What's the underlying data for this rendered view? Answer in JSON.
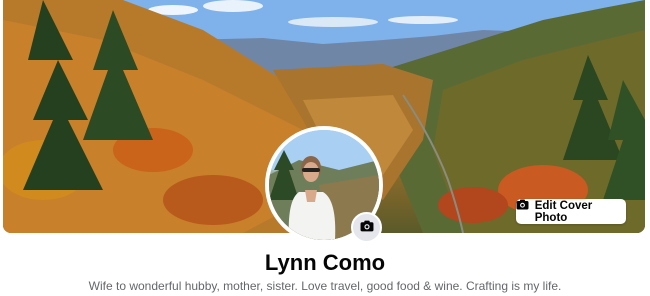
{
  "cover": {
    "edit_button_label": "Edit Cover Photo",
    "edit_button_icon": "camera-icon"
  },
  "profile": {
    "name": "Lynn Como",
    "bio": "Wife to wonderful hubby, mother, sister. Love travel, good food & wine. Crafting is my life.",
    "avatar_camera_icon": "camera-icon"
  },
  "colors": {
    "button_bg": "#ffffff",
    "text_primary": "#050505",
    "text_secondary": "#65676b",
    "camera_badge_bg": "#e4e6eb"
  }
}
